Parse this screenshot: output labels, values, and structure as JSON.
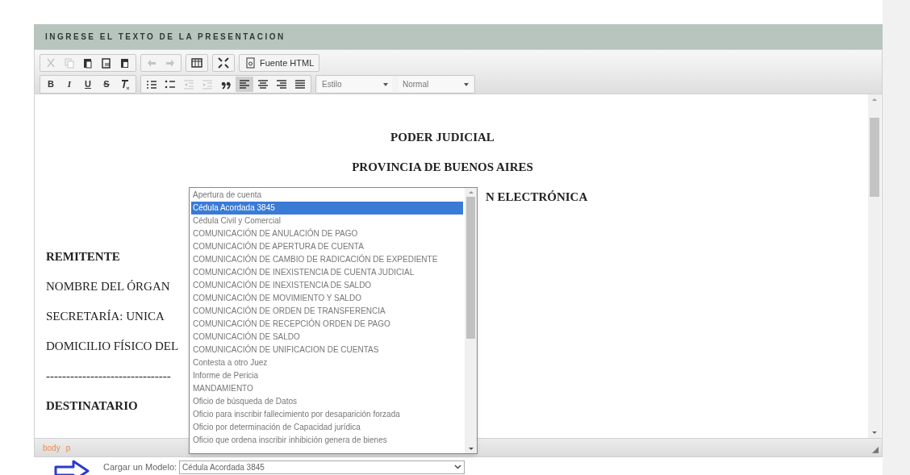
{
  "header": {
    "title": "INGRESE EL TEXTO DE LA PRESENTACION"
  },
  "toolbar": {
    "rows": [
      [
        {
          "buttons": [
            {
              "kind": "cut",
              "disabled": true
            },
            {
              "kind": "copy",
              "disabled": true
            },
            {
              "kind": "paste",
              "disabled": false
            },
            {
              "kind": "paste-text",
              "disabled": false
            },
            {
              "kind": "paste-word",
              "disabled": false
            }
          ]
        },
        {
          "buttons": [
            {
              "kind": "undo",
              "disabled": true
            },
            {
              "kind": "redo",
              "disabled": true
            }
          ]
        },
        {
          "buttons": [
            {
              "kind": "table",
              "disabled": false
            }
          ]
        },
        {
          "buttons": [
            {
              "kind": "maximize",
              "disabled": false
            }
          ]
        },
        {
          "buttons": [
            {
              "kind": "source",
              "label": "Fuente HTML",
              "disabled": false
            }
          ]
        }
      ],
      [
        {
          "buttons": [
            {
              "kind": "bold",
              "label": "B",
              "disabled": false
            },
            {
              "kind": "italic",
              "label": "I",
              "disabled": false
            },
            {
              "kind": "underline",
              "label": "U",
              "disabled": false
            },
            {
              "kind": "strike",
              "label": "S",
              "disabled": false
            },
            {
              "kind": "clear-format",
              "disabled": false
            }
          ]
        },
        {
          "buttons": [
            {
              "kind": "numbered-list",
              "disabled": false
            },
            {
              "kind": "bulleted-list",
              "disabled": false
            },
            {
              "kind": "outdent",
              "disabled": true
            },
            {
              "kind": "indent",
              "disabled": true
            },
            {
              "kind": "blockquote",
              "disabled": false
            },
            {
              "kind": "align-left",
              "disabled": false,
              "active": true
            },
            {
              "kind": "align-center",
              "disabled": false,
              "active": false
            },
            {
              "kind": "align-right",
              "disabled": false,
              "active": false
            },
            {
              "kind": "justify",
              "disabled": false,
              "active": false
            }
          ]
        },
        {
          "combos": [
            {
              "value": "Estilo"
            },
            {
              "value": "Normal"
            }
          ]
        }
      ]
    ]
  },
  "document": {
    "lines": [
      {
        "kind": "center",
        "text": "PODER JUDICIAL"
      },
      {
        "kind": "center",
        "text": "PROVINCIA DE BUENOS AIRES"
      },
      {
        "kind": "partial",
        "text": "N ELECTRÓNICA"
      },
      {
        "kind": "blank"
      },
      {
        "kind": "bold",
        "text": "REMITENTE"
      },
      {
        "kind": "plain",
        "text": "NOMBRE DEL ÓRGAN"
      },
      {
        "kind": "plain",
        "text": "SECRETARÍA: UNICA"
      },
      {
        "kind": "plain",
        "text": "DOMICILIO FÍSICO DEL"
      },
      {
        "kind": "plain",
        "text": "-------------------------------"
      },
      {
        "kind": "bold",
        "text": "DESTINATARIO"
      }
    ]
  },
  "status_bar": {
    "path": [
      "body",
      "p"
    ]
  },
  "model_picker": {
    "label": "Cargar un Modelo:",
    "value": "Cédula Acordada 3845",
    "options": [
      {
        "text": "Apertura de cuenta",
        "selected": false
      },
      {
        "text": "Cédula Acordada 3845",
        "selected": true
      },
      {
        "text": "Cédula Civil y Comercial",
        "selected": false
      },
      {
        "text": "COMUNICACIÓN DE ANULACIÓN DE PAGO",
        "selected": false
      },
      {
        "text": "COMUNICACIÓN DE APERTURA DE CUENTA",
        "selected": false
      },
      {
        "text": "COMUNICACIÓN DE CAMBIO DE RADICACIÓN DE EXPEDIENTE",
        "selected": false
      },
      {
        "text": "COMUNICACIÓN DE INEXISTENCIA DE CUENTA JUDICIAL",
        "selected": false
      },
      {
        "text": "COMUNICACIÓN DE INEXISTENCIA DE SALDO",
        "selected": false
      },
      {
        "text": "COMUNICACIÓN DE MOVIMIENTO Y SALDO",
        "selected": false
      },
      {
        "text": "COMUNICACIÓN DE ORDEN DE TRANSFERENCIA",
        "selected": false
      },
      {
        "text": "COMUNICACIÓN DE RECEPCIÓN ORDEN DE PAGO",
        "selected": false
      },
      {
        "text": "COMUNICACIÓN DE SALDO",
        "selected": false
      },
      {
        "text": "COMUNICACIÓN DE UNIFICACION DE CUENTAS",
        "selected": false
      },
      {
        "text": "Contesta a otro Juez",
        "selected": false
      },
      {
        "text": "Informe de Pericia",
        "selected": false
      },
      {
        "text": "MANDAMIENTO",
        "selected": false
      },
      {
        "text": "Oficio de búsqueda de Datos",
        "selected": false
      },
      {
        "text": "Oficio para inscribir fallecimiento por desaparición forzada",
        "selected": false
      },
      {
        "text": "Oficio por determinación de Capacidad jurídica",
        "selected": false
      },
      {
        "text": "Oficio que ordena inscribir inhibición genera de bienes",
        "selected": false
      }
    ]
  }
}
